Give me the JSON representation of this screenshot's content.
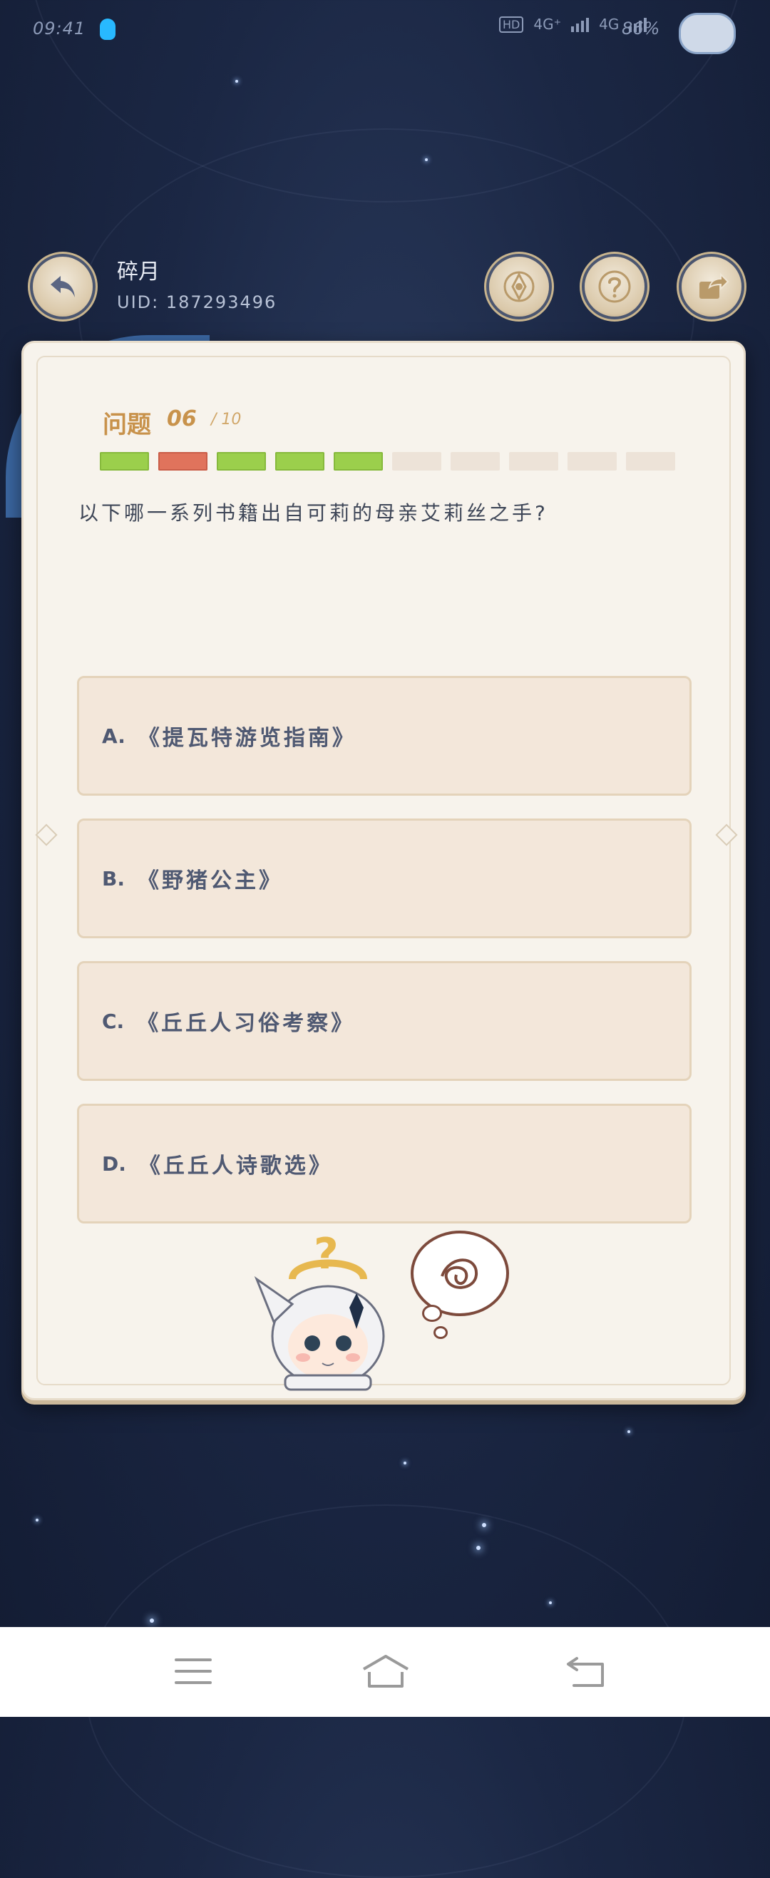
{
  "status_bar": {
    "time": "09:41",
    "network_1": "4G⁺",
    "network_2": "4G",
    "battery": "86%"
  },
  "header": {
    "username": "碎月",
    "uid": "UID: 187293496"
  },
  "quiz": {
    "label": "问题",
    "current": "06",
    "total": "/ 10",
    "progress": [
      "correct",
      "wrong",
      "correct",
      "correct",
      "correct",
      "pending",
      "pending",
      "pending",
      "pending",
      "pending"
    ],
    "question": "以下哪一系列书籍出自可莉的母亲艾莉丝之手?",
    "options": [
      {
        "letter": "A.",
        "text": "《提瓦特游览指南》"
      },
      {
        "letter": "B.",
        "text": "《野猪公主》"
      },
      {
        "letter": "C.",
        "text": "《丘丘人习俗考察》"
      },
      {
        "letter": "D.",
        "text": "《丘丘人诗歌选》"
      }
    ]
  },
  "colors": {
    "accent": "#c8924b",
    "correct": "#9bcf4c",
    "wrong": "#e0735c",
    "pending": "#ede3d8",
    "option_bg": "#f3e7da",
    "background": "#1b2744"
  },
  "icons": {
    "back": "back-arrow-icon",
    "settings": "compass-settings-icon",
    "help": "question-mark-icon",
    "share": "share-icon",
    "nav_menu": "menu-icon",
    "nav_home": "home-icon",
    "nav_back": "back-icon"
  }
}
